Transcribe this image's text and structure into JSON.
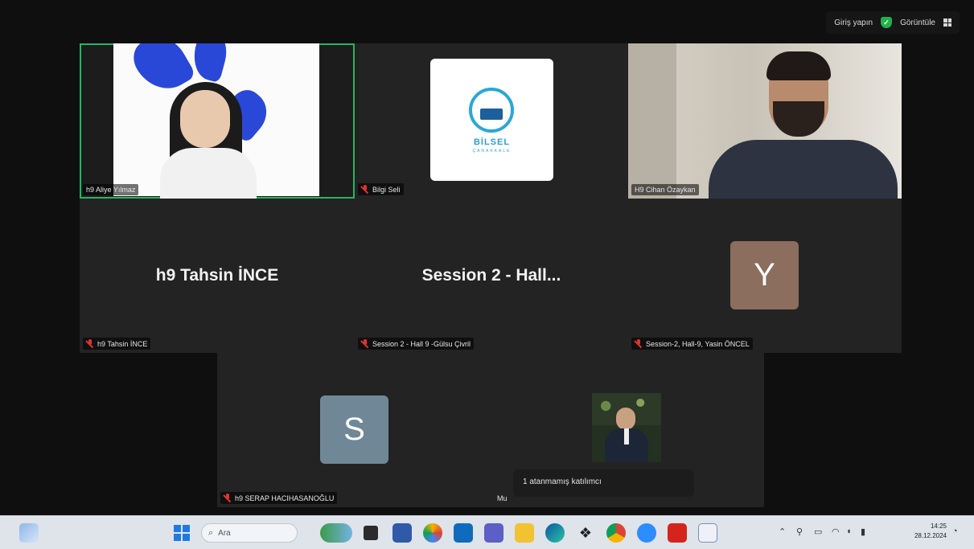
{
  "topbar": {
    "login_label": "Giriş yapın",
    "view_label": "Görüntüle"
  },
  "tiles": [
    {
      "id": "aliye",
      "name": "h9 Aliye Yılmaz",
      "muted": false,
      "active": true
    },
    {
      "id": "bilgi",
      "name": "Bilgi Seli",
      "muted": true,
      "logo_text": "BİLSEL",
      "logo_sub": "ÇANAKKALE"
    },
    {
      "id": "cihan",
      "name": "H9 Cihan Özaykan",
      "muted": false
    },
    {
      "id": "tahsin",
      "name": "h9 Tahsin İNCE",
      "big_label": "h9 Tahsin İNCE",
      "muted": true
    },
    {
      "id": "session",
      "name": "Session 2 - Hall 9 -Gülsu Çivril",
      "big_label": "Session 2 - Hall...",
      "muted": true
    },
    {
      "id": "yasin",
      "name": "Session-2, Hall-9, Yasin ÖNCEL",
      "avatar_letter": "Y",
      "avatar_color": "#8b6e5e",
      "muted": true
    },
    {
      "id": "serap",
      "name": "h9 SERAP HACIHASANOĞLU",
      "avatar_letter": "S",
      "avatar_color": "#6f8797",
      "muted": true
    },
    {
      "id": "mu",
      "name": "Mu",
      "muted": false
    }
  ],
  "tooltip": {
    "text": "1 atanmamış katılımcı"
  },
  "taskbar": {
    "search_placeholder": "Ara",
    "clock_time": "14:25",
    "clock_date": "28.12.2024"
  }
}
